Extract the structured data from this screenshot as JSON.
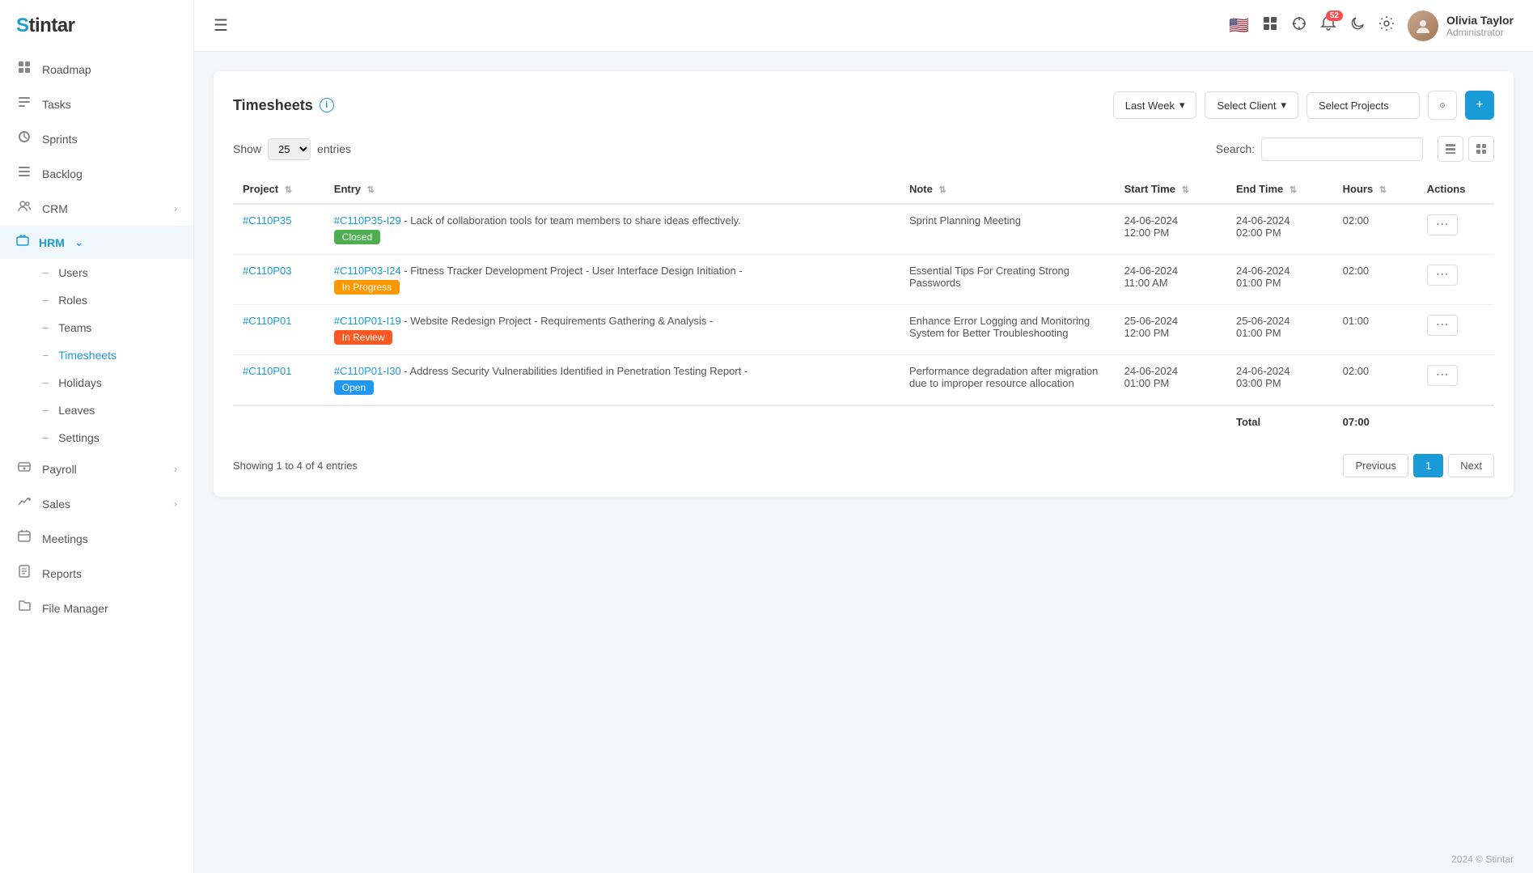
{
  "app": {
    "logo": "Stintar"
  },
  "sidebar": {
    "nav_items": [
      {
        "id": "roadmap",
        "label": "Roadmap",
        "icon": "⊞",
        "has_children": false,
        "active": false
      },
      {
        "id": "tasks",
        "label": "Tasks",
        "icon": "☑",
        "has_children": false,
        "active": false
      },
      {
        "id": "sprints",
        "label": "Sprints",
        "icon": "⟳",
        "has_children": false,
        "active": false
      },
      {
        "id": "backlog",
        "label": "Backlog",
        "icon": "≡",
        "has_children": false,
        "active": false
      },
      {
        "id": "crm",
        "label": "CRM",
        "icon": "👥",
        "has_children": true,
        "active": false
      },
      {
        "id": "hrm",
        "label": "HRM",
        "icon": "🗂",
        "has_children": true,
        "active": true,
        "expanded": true
      },
      {
        "id": "payroll",
        "label": "Payroll",
        "icon": "💰",
        "has_children": true,
        "active": false
      },
      {
        "id": "sales",
        "label": "Sales",
        "icon": "📊",
        "has_children": true,
        "active": false
      },
      {
        "id": "meetings",
        "label": "Meetings",
        "icon": "📅",
        "has_children": false,
        "active": false
      },
      {
        "id": "reports",
        "label": "Reports",
        "icon": "📋",
        "has_children": false,
        "active": false
      },
      {
        "id": "file-manager",
        "label": "File Manager",
        "icon": "📁",
        "has_children": false,
        "active": false
      }
    ],
    "hrm_sub_items": [
      {
        "id": "users",
        "label": "Users",
        "active": false
      },
      {
        "id": "roles",
        "label": "Roles",
        "active": false
      },
      {
        "id": "teams",
        "label": "Teams",
        "active": false
      },
      {
        "id": "timesheets",
        "label": "Timesheets",
        "active": true
      },
      {
        "id": "holidays",
        "label": "Holidays",
        "active": false
      },
      {
        "id": "leaves",
        "label": "Leaves",
        "active": false
      },
      {
        "id": "settings",
        "label": "Settings",
        "active": false
      }
    ]
  },
  "header": {
    "hamburger_label": "☰",
    "notification_count": "52",
    "user": {
      "name": "Olivia Taylor",
      "role": "Administrator"
    }
  },
  "timesheets": {
    "title": "Timesheets",
    "filter_last_week": "Last Week",
    "filter_select_client": "Select Client",
    "filter_select_projects": "Select Projects",
    "show_label": "Show",
    "entries_label": "entries",
    "search_label": "Search:",
    "entries_per_page": "25",
    "columns": [
      {
        "id": "project",
        "label": "Project"
      },
      {
        "id": "entry",
        "label": "Entry"
      },
      {
        "id": "note",
        "label": "Note"
      },
      {
        "id": "start_time",
        "label": "Start Time"
      },
      {
        "id": "end_time",
        "label": "End Time"
      },
      {
        "id": "hours",
        "label": "Hours"
      },
      {
        "id": "actions",
        "label": "Actions"
      }
    ],
    "rows": [
      {
        "project": "#C110P35",
        "entry_id": "#C110P35-I29",
        "entry_desc": "Lack of collaboration tools for team members to share ideas effectively.",
        "entry_status": "Closed",
        "entry_status_class": "badge-closed",
        "note": "Sprint Planning Meeting",
        "start_time": "24-06-2024 12:00 PM",
        "end_time": "24-06-2024 02:00 PM",
        "hours": "02:00"
      },
      {
        "project": "#C110P03",
        "entry_id": "#C110P03-I24",
        "entry_desc": "Fitness Tracker Development Project - User Interface Design Initiation -",
        "entry_status": "In Progress",
        "entry_status_class": "badge-inprogress",
        "note": "Essential Tips For Creating Strong Passwords",
        "start_time": "24-06-2024 11:00 AM",
        "end_time": "24-06-2024 01:00 PM",
        "hours": "02:00"
      },
      {
        "project": "#C110P01",
        "entry_id": "#C110P01-I19",
        "entry_desc": "Website Redesign Project - Requirements Gathering & Analysis -",
        "entry_status": "In Review",
        "entry_status_class": "badge-inreview",
        "note": "Enhance Error Logging and Monitoring System for Better Troubleshooting",
        "start_time": "25-06-2024 12:00 PM",
        "end_time": "25-06-2024 01:00 PM",
        "hours": "01:00"
      },
      {
        "project": "#C110P01",
        "entry_id": "#C110P01-I30",
        "entry_desc": "Address Security Vulnerabilities Identified in Penetration Testing Report -",
        "entry_status": "Open",
        "entry_status_class": "badge-open",
        "note": "Performance degradation after migration due to improper resource allocation",
        "start_time": "24-06-2024 01:00 PM",
        "end_time": "24-06-2024 03:00 PM",
        "hours": "02:00"
      }
    ],
    "total_label": "Total",
    "total_hours": "07:00",
    "showing_text": "Showing 1 to 4 of 4 entries",
    "pagination": {
      "previous": "Previous",
      "page_1": "1",
      "next": "Next"
    },
    "footer": "2024 © Stintar"
  }
}
